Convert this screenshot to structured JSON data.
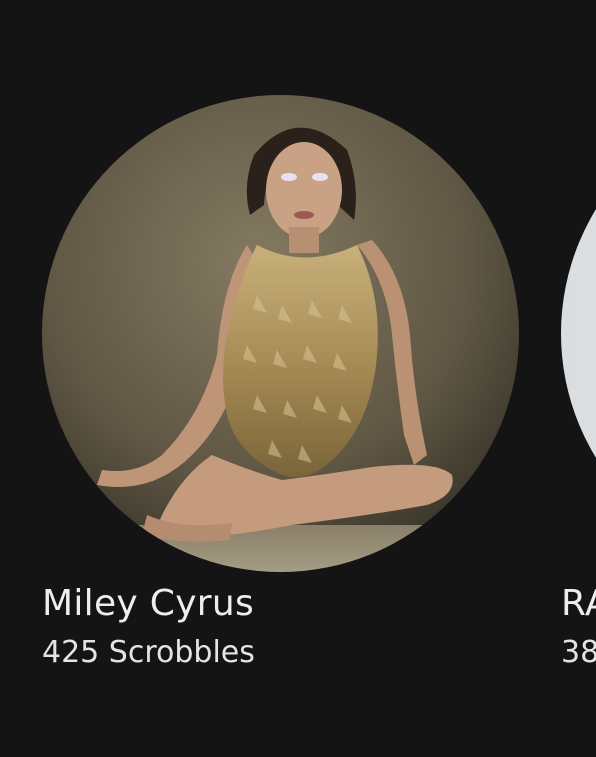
{
  "artists": [
    {
      "name": "Miley Cyrus",
      "scrobbles": "425 Scrobbles",
      "image": "portrait of artist in gold sequined bodysuit, seated, brown backdrop"
    },
    {
      "name": "RA",
      "scrobbles": "38",
      "image": "partially visible light portrait"
    }
  ],
  "colors": {
    "background": "#141414",
    "text": "#eeeeee",
    "photo_backdrop": "#6f6650",
    "gold": "#b8a06a"
  }
}
